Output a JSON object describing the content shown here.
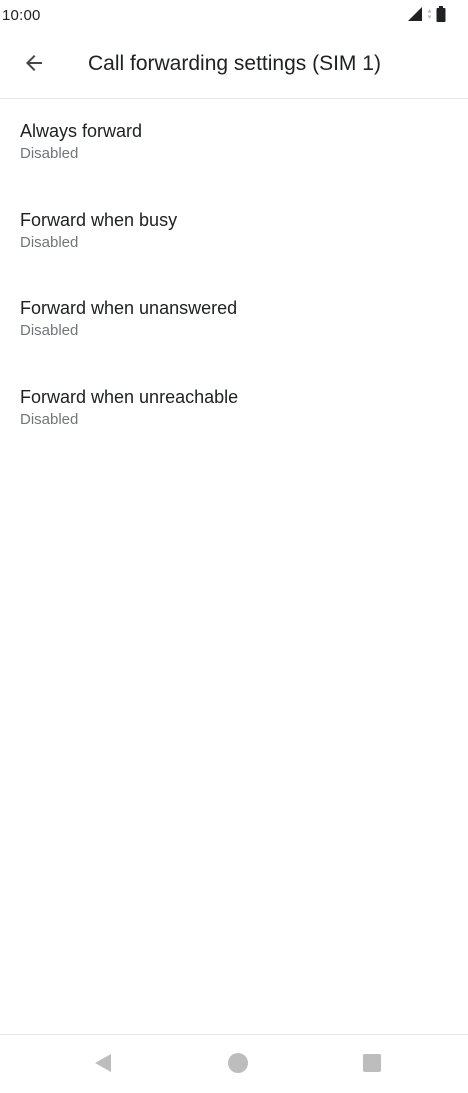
{
  "status_bar": {
    "time": "10:00",
    "icons": [
      "signal-icon",
      "data-arrows-icon",
      "battery-icon"
    ]
  },
  "app_bar": {
    "title": "Call forwarding settings (SIM 1)",
    "back_icon": "arrow-back-icon"
  },
  "preferences": [
    {
      "title": "Always forward",
      "summary": "Disabled"
    },
    {
      "title": "Forward when busy",
      "summary": "Disabled"
    },
    {
      "title": "Forward when unanswered",
      "summary": "Disabled"
    },
    {
      "title": "Forward when unreachable",
      "summary": "Disabled"
    }
  ],
  "nav_bar": {
    "buttons": [
      "back-triangle-icon",
      "home-circle-icon",
      "recents-square-icon"
    ]
  },
  "colors": {
    "text_primary": "#202124",
    "text_secondary": "#70757a",
    "divider": "#e4e4e4",
    "nav_icon": "#bdbdbd",
    "status_icon": "#202124"
  }
}
